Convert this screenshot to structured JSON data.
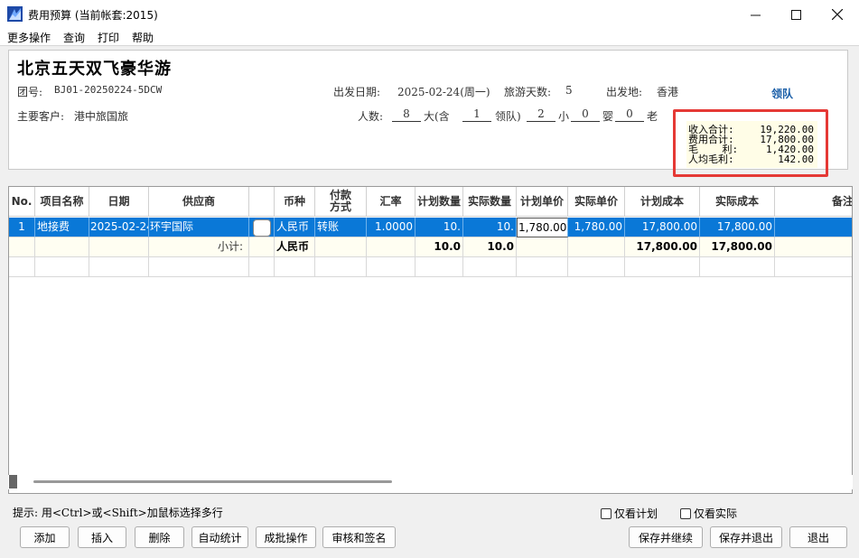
{
  "window": {
    "title": "费用预算 (当前帐套:2015)"
  },
  "menu": [
    "更多操作",
    "查询",
    "打印",
    "帮助"
  ],
  "header": {
    "tour_name": "北京五天双飞豪华游",
    "group_no_label": "团号:",
    "group_no": "BJ01-20250224-5DCW",
    "depart_date_label": "出发日期:",
    "depart_date": "2025-02-24(周一)",
    "days_label": "旅游天数:",
    "days": "5",
    "origin_label": "出发地:",
    "origin": "香港",
    "customer_label": "主要客户:",
    "customer": "港中旅国旅",
    "people_label": "人数:",
    "people": "8",
    "adult_label": "大(含",
    "leaders": "1",
    "leader_suffix": "领队)",
    "children": "2",
    "child_label": "小",
    "infants": "0",
    "infant_label": "婴",
    "elders": "0",
    "elder_label": "老",
    "leader_tag": "领队"
  },
  "summary": {
    "income_label": "收入合计:",
    "income": "19,220.00",
    "cost_label": "费用合计:",
    "cost": "17,800.00",
    "profit_label": "毛    利:",
    "profit": "1,420.00",
    "per_capita_label": "人均毛利:",
    "per_capita": "142.00"
  },
  "grid": {
    "columns": [
      "No.",
      "项目名称",
      "日期",
      "供应商",
      "",
      "币种",
      "付款\n方式",
      "汇率",
      "计划数量",
      "实际数量",
      "计划单价",
      "实际单价",
      "计划成本",
      "实际成本",
      "备注"
    ],
    "rows": [
      {
        "no": "1",
        "item": "地接费",
        "date": "2025-02-24",
        "supplier": "环宇国际",
        "currency": "人民币",
        "payment": "转账",
        "rate": "1.0000",
        "plan_qty": "10.",
        "actual_qty": "10.",
        "plan_price": "1,780.00",
        "actual_price": "1,780.00",
        "plan_cost": "17,800.00",
        "actual_cost": "17,800.00"
      }
    ],
    "subtotal": {
      "label": "小计:",
      "currency": "人民币",
      "plan_qty": "10.0",
      "actual_qty": "10.0",
      "plan_cost": "17,800.00",
      "actual_cost": "17,800.00"
    }
  },
  "footer": {
    "hint": "提示: 用<Ctrl>或<Shift>加鼠标选择多行",
    "only_plan": "仅看计划",
    "only_actual": "仅看实际",
    "buttons": {
      "add": "添加",
      "insert": "插入",
      "delete": "删除",
      "auto_stat": "自动统计",
      "batch": "成批操作",
      "review": "审核和签名",
      "save_continue": "保存并继续",
      "save_exit": "保存并退出",
      "exit": "退出"
    }
  },
  "colors": {
    "selection": "#0a78d7",
    "highlight_border": "#e53935",
    "leader_tag": "#1b5fa8"
  }
}
